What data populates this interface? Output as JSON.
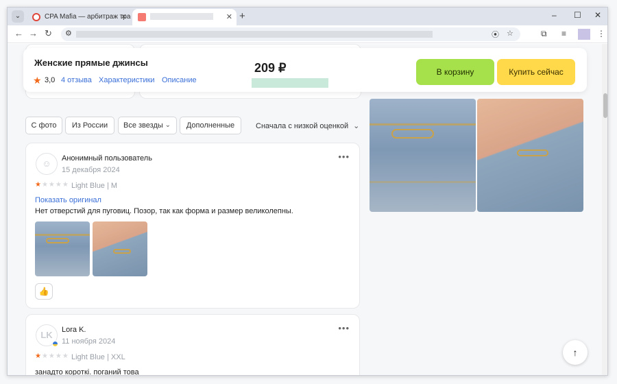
{
  "browser": {
    "tabs": [
      {
        "title": "CPA Mafia — арбитраж трафи"
      },
      {
        "title": ""
      }
    ],
    "new_tab": "+",
    "window_controls": [
      "–",
      "☐",
      "✕"
    ]
  },
  "product": {
    "title": "Женские прямые джинсы",
    "rating": "3,0",
    "reviews_link": "4 отзыва",
    "specs_link": "Характеристики",
    "description_link": "Описание",
    "price": "209 ₽",
    "cart_button": "В корзину",
    "buy_button": "Купить сейчас"
  },
  "filters": {
    "chips": [
      "С фото",
      "Из России",
      "Все звезды",
      "Дополненные"
    ],
    "sort": "Сначала с низкой оценкой"
  },
  "reviews": [
    {
      "author": "Анонимный пользователь",
      "date": "15 декабря 2024",
      "stars": 1,
      "variant": "Light Blue | M",
      "show_original": "Показать оригинал",
      "text": "Нет отверстий для пуговиц. Позор, так как форма и размер великолепны."
    },
    {
      "author": "Lora K.",
      "initials": "LK",
      "date": "11 ноября 2024",
      "stars": 1,
      "variant": "Light Blue | XXL",
      "text": "занадто короткі. поганий това"
    }
  ],
  "icons": {
    "rating_star": "star-icon",
    "like": "thumbs-up-icon",
    "more": "more-horizontal-icon",
    "scroll_top": "arrow-up-icon",
    "chevron": "chevron-down-icon"
  },
  "colors": {
    "cart_green": "#a6e04a",
    "buy_yellow": "#ffd94a",
    "link_blue": "#3a6fd8",
    "star_orange": "#f26a1b"
  }
}
